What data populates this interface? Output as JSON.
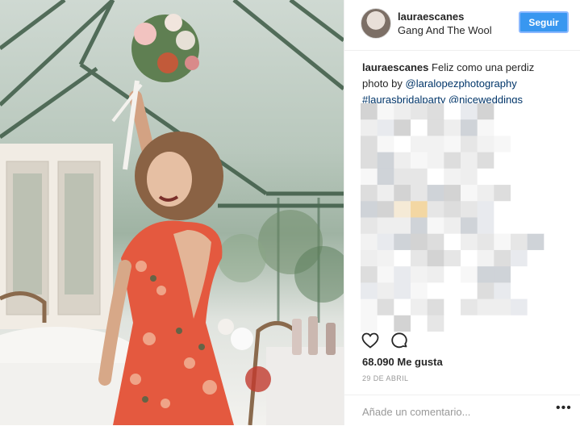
{
  "header": {
    "username": "lauraescanes",
    "subtitle": "Gang And The Wool",
    "follow_label": "Seguir"
  },
  "caption": {
    "username": "lauraescanes",
    "text": "Feliz como una perdiz",
    "line2_prefix": "photo by ",
    "photographer": "@laralopezphotography",
    "hashtag": "#laurasbridalparty",
    "mention": "@niceweddings"
  },
  "actions": {
    "like_icon": "heart-icon",
    "comment_icon": "comment-icon"
  },
  "likes": "68.090 Me gusta",
  "date": "29 DE ABRIL",
  "comment": {
    "placeholder": "Añade un comentario...",
    "more_label": "•••"
  },
  "colors": {
    "follow_button": "#3897f0",
    "link": "#003569",
    "dress": "#e4593f"
  }
}
